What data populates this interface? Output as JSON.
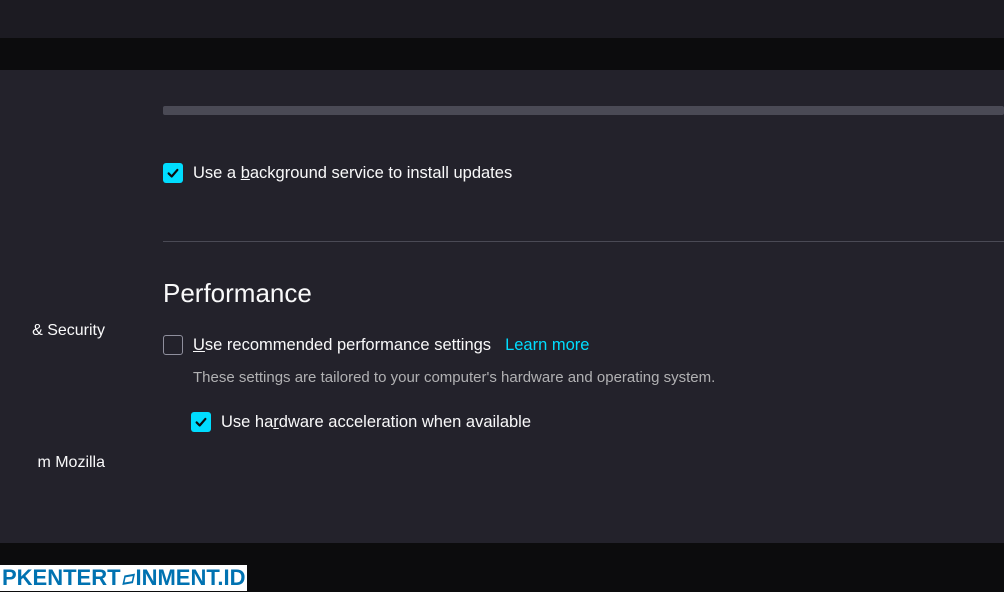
{
  "sidebar": {
    "items": [
      {
        "label": "& Security"
      },
      {
        "label": "m Mozilla"
      }
    ]
  },
  "updates": {
    "background_service": {
      "label_pre": "Use a ",
      "label_key": "b",
      "label_post": "ackground service to install updates",
      "checked": true
    }
  },
  "performance": {
    "heading": "Performance",
    "recommended": {
      "label_key": "U",
      "label_post": "se recommended performance settings",
      "checked": false,
      "learn_more": "Learn more"
    },
    "description": "These settings are tailored to your computer's hardware and operating system.",
    "hardware_accel": {
      "label_pre": "Use ha",
      "label_key": "r",
      "label_post": "dware acceleration when available",
      "checked": true
    }
  },
  "watermark": "PKENTERTINMENT.ID"
}
